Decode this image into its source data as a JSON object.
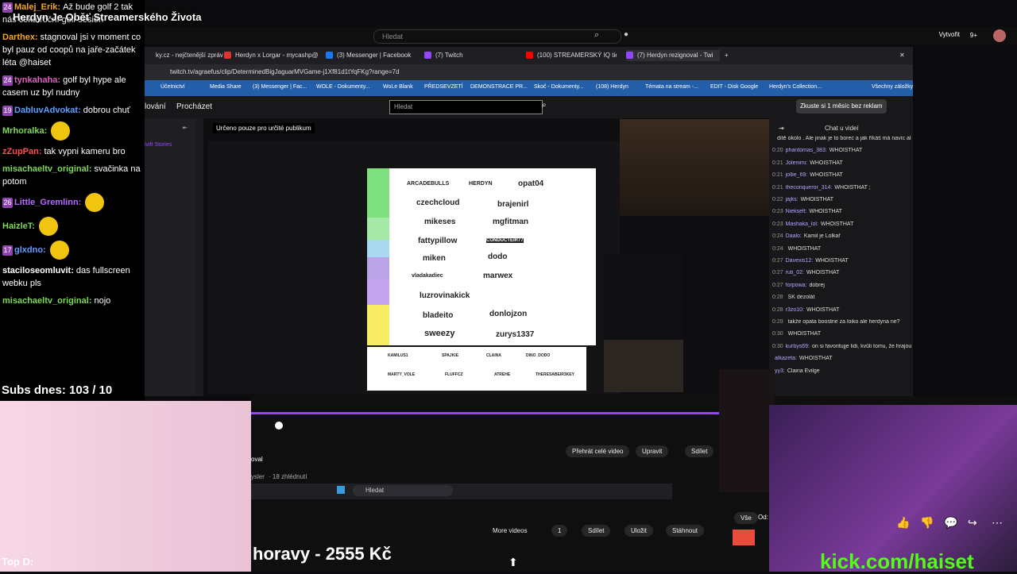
{
  "overlay": {
    "stream_title": "Herdyn Je Oběť Streamerského Života",
    "subs": "Subs dnes: 103 / 10",
    "top_d": "Top D:",
    "kick": "kick.com/haiset",
    "bottom_text": "horavy - 2555 Kč"
  },
  "chat": [
    {
      "badge": "24",
      "user": "Malej_Erik:",
      "text": "Až bude golf 2 tak nás čeká roční golf sesion",
      "color": "#f5a623"
    },
    {
      "badge": "",
      "user": "Darthex:",
      "text": "stagnoval jsi v moment co byl pauz od coopů na jaře-začátek léta @haiset",
      "color": "#f5a623"
    },
    {
      "badge": "24",
      "user": "tynkahaha:",
      "text": "golf byl hype ale casem uz byl nudny",
      "color": "#e05fbf"
    },
    {
      "badge": "19",
      "user": "DabluvAdvokat:",
      "text": "dobrou chuť",
      "color": "#5ea0ff"
    },
    {
      "badge": "",
      "user": "Mrhoralka:",
      "text": "",
      "color": "#7ed957"
    },
    {
      "badge": "",
      "user": "zZupPan:",
      "text": "tak vypni kameru bro",
      "color": "#ff5050"
    },
    {
      "badge": "",
      "user": "misachaeltv_original:",
      "text": "svačinka na potom",
      "color": "#7ed957"
    },
    {
      "badge": "26",
      "user": "Little_Gremlinn:",
      "text": "",
      "color": "#b46bff"
    },
    {
      "badge": "",
      "user": "HaizleT:",
      "text": "",
      "color": "#7ed957"
    },
    {
      "badge": "17",
      "user": "glxdno:",
      "text": "",
      "color": "#5ea0ff"
    },
    {
      "badge": "",
      "user": "staciloseomluvit:",
      "text": "das fullscreen webku pls",
      "color": "#ffffff"
    },
    {
      "badge": "",
      "user": "misachaeltv_original:",
      "text": "nojo",
      "color": "#7ed957"
    }
  ],
  "youtube": {
    "search_placeholder": "Hledat",
    "create_label": "Vytvořit",
    "notif_count": "9+"
  },
  "browser": {
    "tabs": [
      "ky.cz - nejčtenější zpráv",
      "Herdyn x Lorgar - mycashp@",
      "(3) Messenger | Facebook",
      "(7) Twitch",
      "(100) STREAMERSKÝ IQ tier list",
      "(7) Herdyn rezignoval - Twi"
    ],
    "url": "twitch.tv/agraefus/clip/DeterminedBigJaguarMVGame-j1Xf81d1tYqFKg?range=7d",
    "bookmarks": [
      "Účetnictví",
      "Media Share",
      "(3) Messenger | Fac...",
      "WOLE - Dokumenty...",
      "WoLe Blank",
      "PŘEDSEVZETÍ",
      "DEMONSTRACE PR...",
      "Skoč - Dokumenty...",
      "(108) Herdyn",
      "Témata na stream -...",
      "EDIT - Disk Google",
      "Herdyn's Collection...",
      "Všechny záložky"
    ]
  },
  "twitch": {
    "nav_browse_prefix": "lování",
    "nav_browse": "Procházet",
    "search_placeholder": "Hledat",
    "promo": "Zkuste si 1 měsíc bez reklam",
    "audience": "Určeno pouze pro určité publikum",
    "sidebar_title": "ivift Stories",
    "chat_title": "Chat u videí",
    "chat": [
      {
        "t": "",
        "u": "",
        "m": "dítě okolo . Ale jinak je to borec a jak říkáš má navíc ale chybí mu ta jiskra."
      },
      {
        "t": "0:20",
        "u": "phantomas_383:",
        "m": "WHOISTHAT"
      },
      {
        "t": "0:21",
        "u": "Jolenimi:",
        "m": "WHOISTHAT"
      },
      {
        "t": "0:21",
        "u": "jollie_69:",
        "m": "WHOISTHAT"
      },
      {
        "t": "0:21",
        "u": "theconqueror_314:",
        "m": "WHOISTHAT ;"
      },
      {
        "t": "0:22",
        "u": "jajks:",
        "m": "WHOISTHAT"
      },
      {
        "t": "0:23",
        "u": "Niekselt:",
        "m": "WHOISTHAT"
      },
      {
        "t": "0:23",
        "u": "Mashaka_lol:",
        "m": "WHOISTHAT"
      },
      {
        "t": "0:24",
        "u": "Daalo:",
        "m": "Kamil je Lolkař"
      },
      {
        "t": "0:24",
        "u": "",
        "m": "WHOISTHAT"
      },
      {
        "t": "0:27",
        "u": "Davexis12:",
        "m": "WHOISTHAT"
      },
      {
        "t": "0:27",
        "u": "ruti_02:",
        "m": "WHOISTHAT"
      },
      {
        "t": "0:27",
        "u": "forpowa:",
        "m": "dobrej"
      },
      {
        "t": "0:28",
        "u": "",
        "m": "SK dezolát"
      },
      {
        "t": "0:28",
        "u": "r3zo10:",
        "m": "WHOISTHAT"
      },
      {
        "t": "0:29",
        "u": "",
        "m": "takže opata boostne za loiko ale herdyna ne?"
      },
      {
        "t": "0:30",
        "u": "",
        "m": "WHOISTHAT"
      },
      {
        "t": "0:30",
        "u": "kurbys69:",
        "m": "on si favoritujje lidi, kvůli tomu, že hrajou lolko xd"
      },
      {
        "t": "",
        "u": "alkazeta:",
        "m": "WHOISTHAT"
      },
      {
        "t": "",
        "u": "yy3:",
        "m": "Claina Evilge"
      }
    ]
  },
  "tierlist": {
    "names": [
      "ARCADEBULLS",
      "HERDYN",
      "opat04",
      "czechcloud",
      "brajenirl",
      "mikeses",
      "mgfitman",
      "fattypillow",
      "CONDUCTEIR77",
      "miken",
      "dodo",
      "vladakadiec",
      "marwex",
      "luzrovinakick",
      "bladeito",
      "donlojzon",
      "sweezy",
      "zurys1337"
    ],
    "bottom_names": [
      "KAMILUS1",
      "SPAJKIE",
      "CLAINA",
      "DINO_DODO",
      "MARTY_VOLE",
      "FLUFFCZ",
      "ATREHE",
      "THERESABEIR3KEY"
    ]
  },
  "yt_buttons": {
    "play_full": "Přehrát celé video",
    "edit": "Upravit",
    "share": "Sdílet",
    "views_prefix": "ysler",
    "views": "· 18 zhlédnutí",
    "channel_partial": "oval",
    "more_videos": "More videos",
    "dislike_count": "1",
    "share2": "Sdílet",
    "save": "Uložit",
    "download": "Stáhnout",
    "all": "Vše",
    "from": "Od:"
  },
  "taskbar": {
    "search": "Hledat"
  },
  "colors": {
    "twitch_purple": "#9147ff",
    "kick_green": "#53fc18",
    "bookmark_bar": "#235ea8"
  }
}
